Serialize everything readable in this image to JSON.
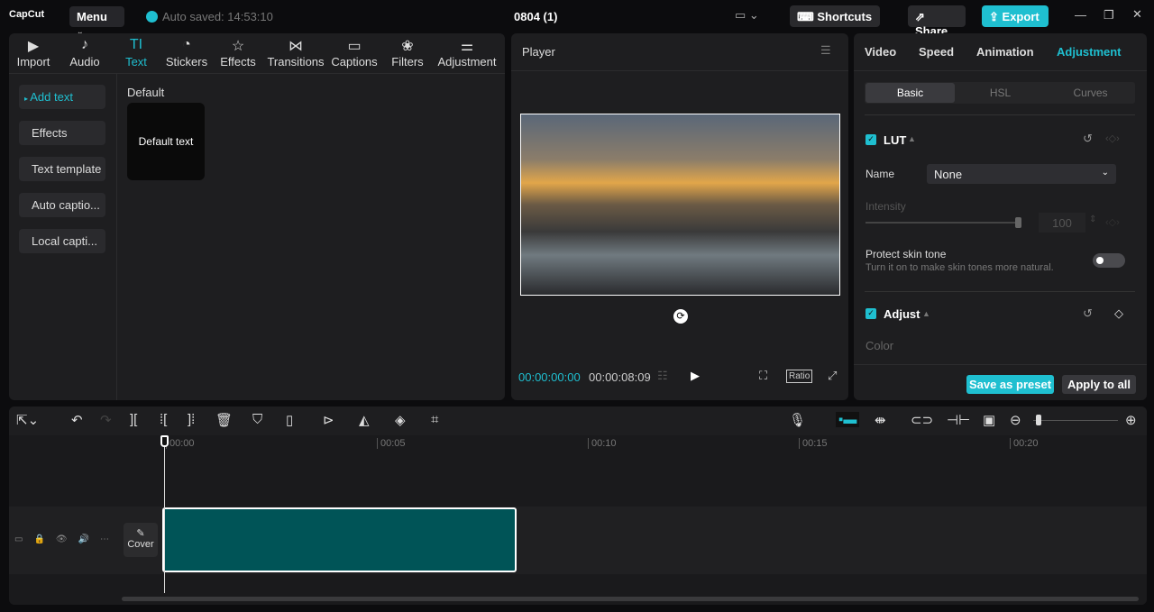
{
  "app": {
    "logo": "CapCut",
    "menu": "Menu",
    "auto_saved": "Auto saved: 14:53:10",
    "project_title": "0804 (1)",
    "shortcuts": "Shortcuts",
    "share": "Share",
    "export": "Export"
  },
  "media_tabs": [
    {
      "label": "Import",
      "icon": "▶"
    },
    {
      "label": "Audio",
      "icon": "♪"
    },
    {
      "label": "Text",
      "icon": "TI"
    },
    {
      "label": "Stickers",
      "icon": "◔"
    },
    {
      "label": "Effects",
      "icon": "☆"
    },
    {
      "label": "Transitions",
      "icon": "⋈"
    },
    {
      "label": "Captions",
      "icon": "▭"
    },
    {
      "label": "Filters",
      "icon": "❀"
    },
    {
      "label": "Adjustment",
      "icon": "⚌"
    }
  ],
  "text_sidebar": [
    "Add text",
    "Effects",
    "Text template",
    "Auto captio...",
    "Local capti..."
  ],
  "text_section": {
    "heading": "Default",
    "card": "Default text"
  },
  "player": {
    "title": "Player",
    "current_time": "00:00:00:00",
    "duration": "00:00:08:09",
    "ratio": "Ratio"
  },
  "right_tabs": [
    "Video",
    "Speed",
    "Animation",
    "Adjustment"
  ],
  "sub_tabs": [
    "Basic",
    "HSL",
    "Curves"
  ],
  "lut": {
    "title": "LUT",
    "name_label": "Name",
    "name_value": "None",
    "intensity_label": "Intensity",
    "intensity_value": "100",
    "intensity": 1.0,
    "protect_title": "Protect skin tone",
    "protect_desc": "Turn it on to make skin tones more natural."
  },
  "adjust": {
    "title": "Adjust",
    "color_label": "Color"
  },
  "footer": {
    "save_preset": "Save as preset",
    "apply_all": "Apply to all"
  },
  "timeline": {
    "ticks": [
      "00:00",
      "00:05",
      "00:10",
      "00:15",
      "00:20"
    ],
    "cover": "Cover",
    "clip_color": "#005457"
  }
}
